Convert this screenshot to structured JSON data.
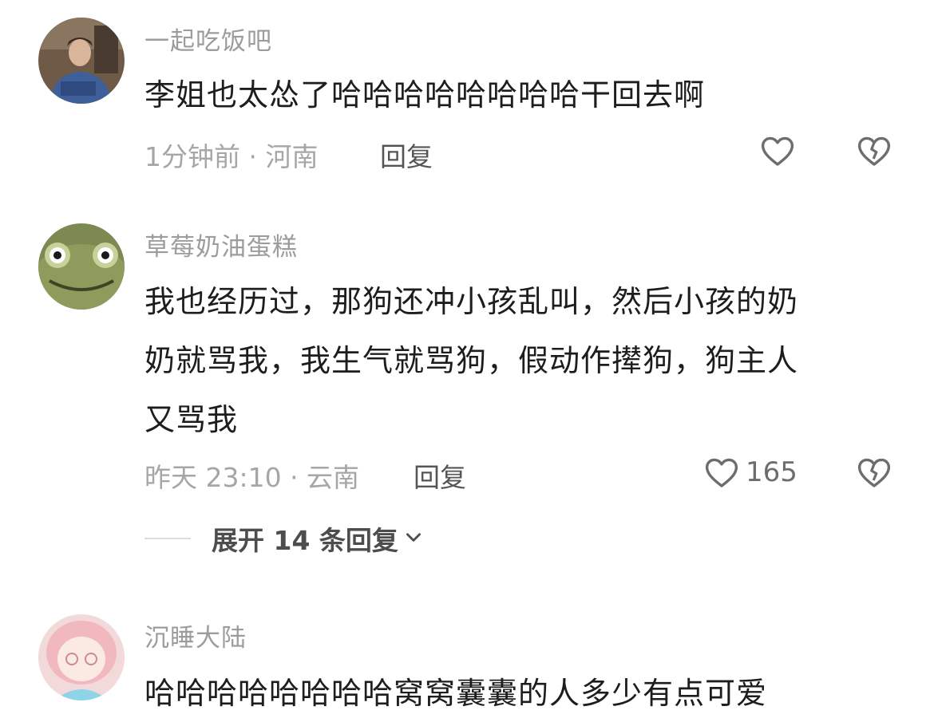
{
  "comments": [
    {
      "username": "一起吃饭吧",
      "lines": [
        "李姐也太怂了哈哈哈哈哈哈哈哈干回去啊"
      ],
      "meta": "1分钟前 · 河南",
      "reply_label": "回复",
      "like_count": ""
    },
    {
      "username": "草莓奶油蛋糕",
      "lines": [
        "我也经历过，那狗还冲小孩乱叫，然后小孩的奶",
        "奶就骂我，我生气就骂狗，假动作撵狗，狗主人",
        "又骂我"
      ],
      "meta": "昨天 23:10 · 云南",
      "reply_label": "回复",
      "like_count": "165"
    },
    {
      "username": "沉睡大陆",
      "lines": [
        "哈哈哈哈哈哈哈哈窝窝囊囊的人多少有点可爱"
      ]
    }
  ],
  "expand_replies": {
    "label": "展开 14 条回复"
  },
  "icons": {
    "like": "heart-outline-icon",
    "dislike": "broken-heart-icon",
    "expand": "chevron-down-icon"
  },
  "colors": {
    "username": "#9c9c9c",
    "meta": "#a6a6a6",
    "icon": "#6d6d6d"
  }
}
